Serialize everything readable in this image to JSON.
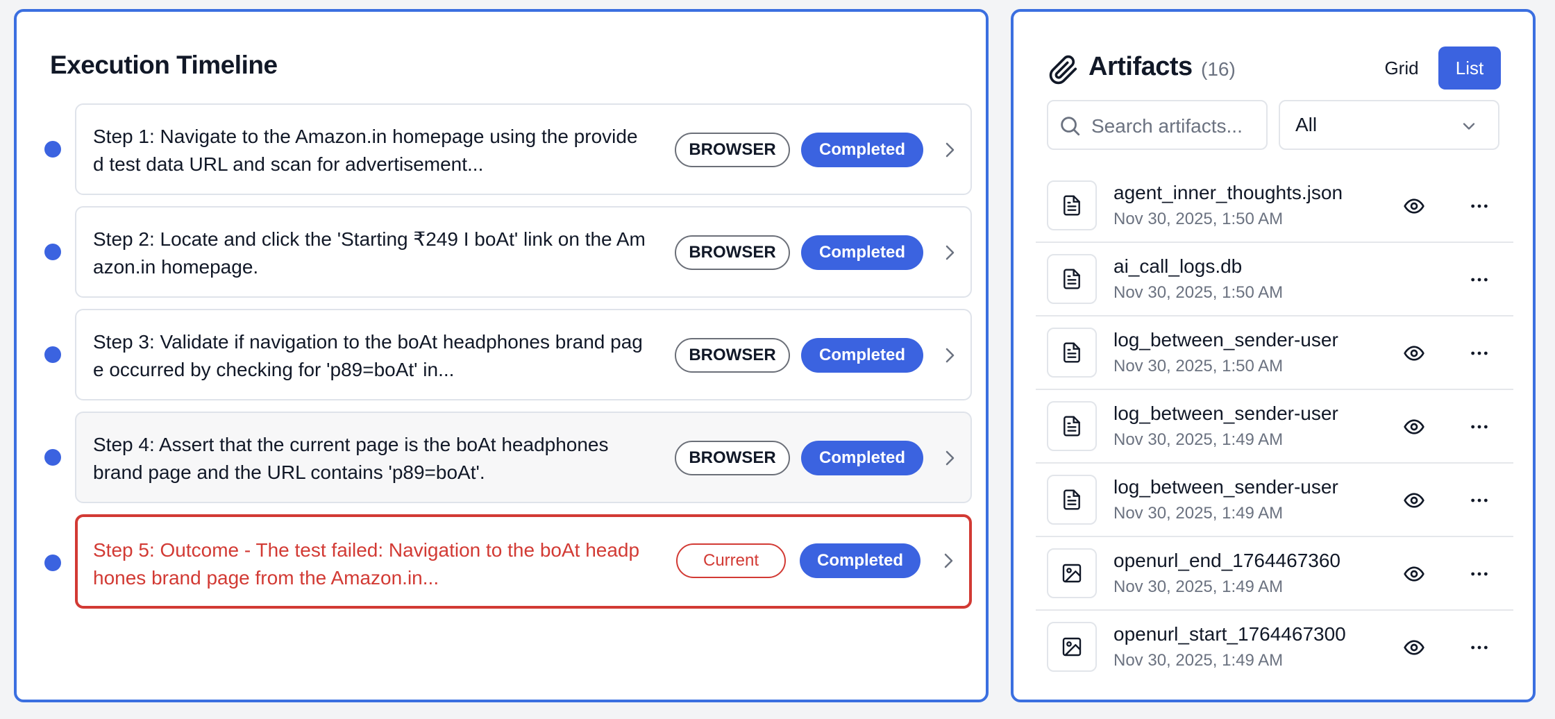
{
  "timeline": {
    "title": "Execution Timeline",
    "steps": [
      {
        "text": "Step 1: Navigate to the Amazon.in homepage using the provided test data URL and scan for advertisement...",
        "type": "BROWSER",
        "status": "Completed"
      },
      {
        "text": "Step 2: Locate and click the 'Starting ₹249 I boAt' link on the Amazon.in homepage.",
        "type": "BROWSER",
        "status": "Completed"
      },
      {
        "text": "Step 3: Validate if navigation to the boAt headphones brand page occurred by checking for 'p89=boAt' in...",
        "type": "BROWSER",
        "status": "Completed"
      },
      {
        "text": "Step 4: Assert that the current page is the boAt headphones brand page and the URL contains 'p89=boAt'.",
        "type": "BROWSER",
        "status": "Completed"
      },
      {
        "text": "Step 5: Outcome - The test failed: Navigation to the boAt headphones brand page from the Amazon.in...",
        "type": "Current",
        "status": "Completed"
      }
    ]
  },
  "artifacts": {
    "title": "Artifacts",
    "count": "(16)",
    "view_grid": "Grid",
    "view_list": "List",
    "search_placeholder": "Search artifacts...",
    "filter_value": "All",
    "items": [
      {
        "name": "agent_inner_thoughts.json",
        "date": "Nov 30, 2025, 1:50 AM",
        "icon": "file-text-icon",
        "has_preview": true
      },
      {
        "name": "ai_call_logs.db",
        "date": "Nov 30, 2025, 1:50 AM",
        "icon": "file-text-icon",
        "has_preview": false
      },
      {
        "name": "log_between_sender-user",
        "date": "Nov 30, 2025, 1:50 AM",
        "icon": "file-text-icon",
        "has_preview": true
      },
      {
        "name": "log_between_sender-user",
        "date": "Nov 30, 2025, 1:49 AM",
        "icon": "file-text-icon",
        "has_preview": true
      },
      {
        "name": "log_between_sender-user",
        "date": "Nov 30, 2025, 1:49 AM",
        "icon": "file-text-icon",
        "has_preview": true
      },
      {
        "name": "openurl_end_1764467360",
        "date": "Nov 30, 2025, 1:49 AM",
        "icon": "image-icon",
        "has_preview": true
      },
      {
        "name": "openurl_start_1764467300",
        "date": "Nov 30, 2025, 1:49 AM",
        "icon": "image-icon",
        "has_preview": true
      }
    ]
  },
  "colors": {
    "accent": "#3b63e0",
    "panel_border": "#3b6fe0",
    "error": "#d23a34"
  }
}
